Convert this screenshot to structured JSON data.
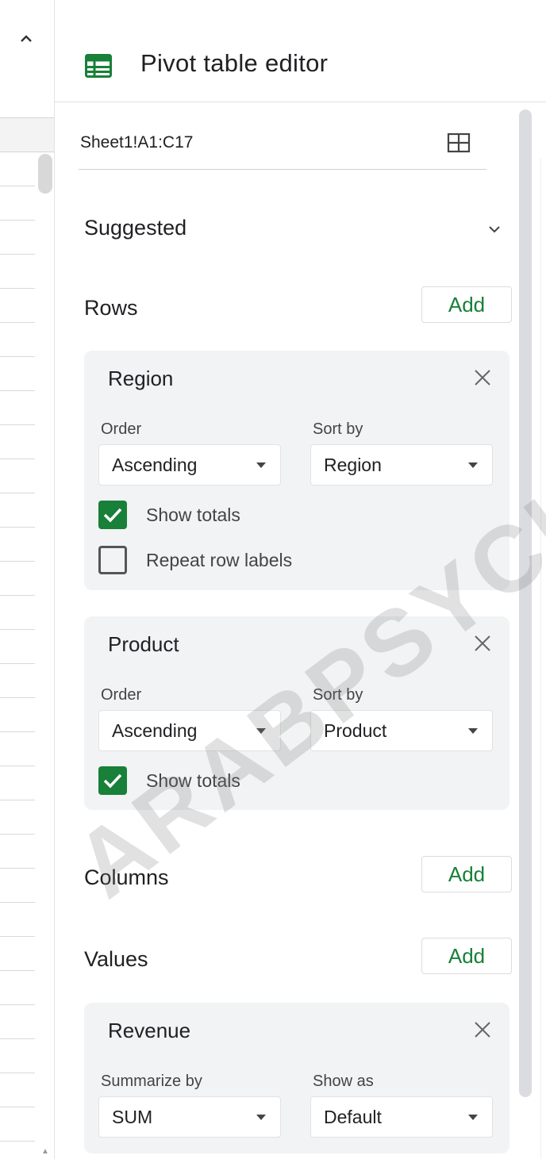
{
  "panel": {
    "title": "Pivot table editor",
    "data_range": "Sheet1!A1:C17",
    "accent_color": "#188038"
  },
  "suggested": {
    "label": "Suggested"
  },
  "rows": {
    "label": "Rows",
    "add_label": "Add",
    "fields": [
      {
        "name": "Region",
        "order_label": "Order",
        "order_value": "Ascending",
        "sort_label": "Sort by",
        "sort_value": "Region",
        "show_totals_label": "Show totals",
        "show_totals": true,
        "repeat_label": "Repeat row labels",
        "repeat_row_labels": false
      },
      {
        "name": "Product",
        "order_label": "Order",
        "order_value": "Ascending",
        "sort_label": "Sort by",
        "sort_value": "Product",
        "show_totals_label": "Show totals",
        "show_totals": true
      }
    ]
  },
  "columns": {
    "label": "Columns",
    "add_label": "Add"
  },
  "values": {
    "label": "Values",
    "add_label": "Add",
    "fields": [
      {
        "name": "Revenue",
        "summarize_label": "Summarize by",
        "summarize_value": "SUM",
        "show_as_label": "Show as",
        "show_as_value": "Default"
      }
    ]
  },
  "watermark": "ARABPSYCHO"
}
